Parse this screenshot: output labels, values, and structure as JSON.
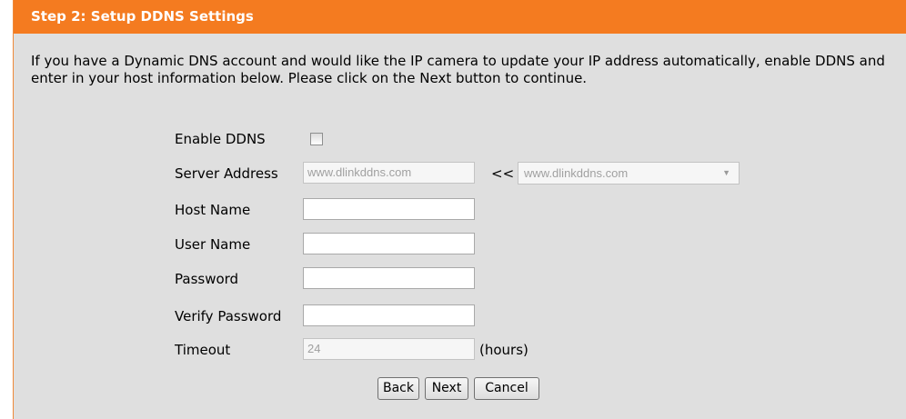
{
  "header": {
    "title": "Step 2: Setup DDNS Settings"
  },
  "description": "If you have a Dynamic DNS account and would like the IP camera to update your IP address automatically, enable DDNS and enter in your host information below. Please click on the Next button to continue.",
  "form": {
    "enable_ddns": {
      "label": "Enable DDNS",
      "checked": false
    },
    "server_address": {
      "label": "Server Address",
      "value": "www.dlinkddns.com",
      "arrows": "<<",
      "select_value": "www.dlinkddns.com"
    },
    "host_name": {
      "label": "Host Name",
      "value": ""
    },
    "user_name": {
      "label": "User Name",
      "value": ""
    },
    "password": {
      "label": "Password",
      "value": ""
    },
    "verify_password": {
      "label": "Verify Password",
      "value": ""
    },
    "timeout": {
      "label": "Timeout",
      "value": "24",
      "unit": "(hours)"
    }
  },
  "buttons": {
    "back": "Back",
    "next": "Next",
    "cancel": "Cancel"
  }
}
